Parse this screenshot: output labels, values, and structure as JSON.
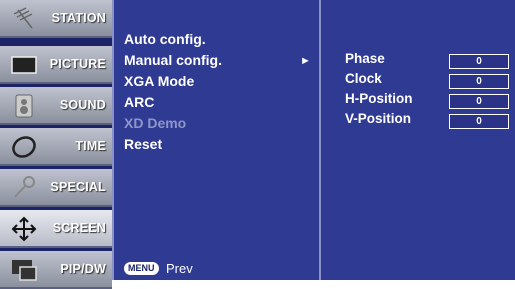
{
  "sidebar": {
    "items": [
      {
        "label": "STATION",
        "icon": "antenna-icon"
      },
      {
        "label": "PICTURE",
        "icon": "tv-picture-icon"
      },
      {
        "label": "SOUND",
        "icon": "speaker-icon"
      },
      {
        "label": "TIME",
        "icon": "clock-icon"
      },
      {
        "label": "SPECIAL",
        "icon": "key-icon"
      },
      {
        "label": "SCREEN",
        "icon": "move-arrows-icon",
        "active": true
      },
      {
        "label": "PIP/DW",
        "icon": "pip-icon"
      }
    ]
  },
  "menu": {
    "items": [
      {
        "label": "Auto config."
      },
      {
        "label": "Manual config.",
        "has_submenu": true
      },
      {
        "label": "XGA Mode"
      },
      {
        "label": "ARC"
      },
      {
        "label": "XD Demo",
        "disabled": true
      },
      {
        "label": "Reset"
      }
    ],
    "arrow": "►"
  },
  "submenu": {
    "items": [
      {
        "label": "Phase",
        "value": "0"
      },
      {
        "label": "Clock",
        "value": "0"
      },
      {
        "label": "H-Position",
        "value": "0"
      },
      {
        "label": "V-Position",
        "value": "0"
      }
    ]
  },
  "footer": {
    "menu_button": "MENU",
    "prev_label": "Prev"
  },
  "colors": {
    "panel": "#2f3a93",
    "sidebar": "#1c2466"
  }
}
